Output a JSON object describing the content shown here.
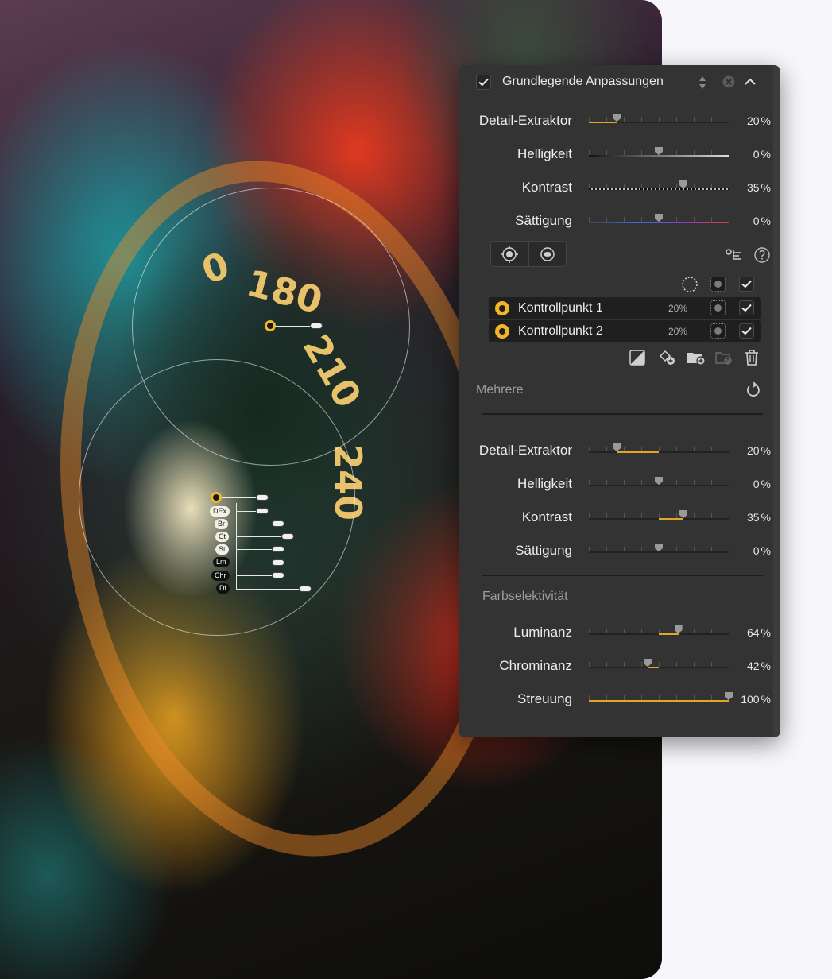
{
  "panel": {
    "title": "Grundlegende Anpassungen",
    "top_sliders": [
      {
        "label": "Detail-Extraktor",
        "value": "20",
        "unit": "%",
        "level": 0.2
      },
      {
        "label": "Helligkeit",
        "value": "0",
        "unit": "%",
        "level": 0.0
      },
      {
        "label": "Kontrast",
        "value": "35",
        "unit": "%",
        "level": 0.35
      },
      {
        "label": "Sättigung",
        "value": "0",
        "unit": "%",
        "level": 0.0
      }
    ],
    "control_points": [
      {
        "name": "Kontrollpunkt 1",
        "percent": "20%"
      },
      {
        "name": "Kontrollpunkt 2",
        "percent": "20%"
      }
    ],
    "multi_section": "Mehrere",
    "bottom_sliders": [
      {
        "label": "Detail-Extraktor",
        "value": "20",
        "unit": "%",
        "level": 0.2
      },
      {
        "label": "Helligkeit",
        "value": "0",
        "unit": "%",
        "level": 0.0
      },
      {
        "label": "Kontrast",
        "value": "35",
        "unit": "%",
        "level": 0.35
      },
      {
        "label": "Sättigung",
        "value": "0",
        "unit": "%",
        "level": 0.0
      }
    ],
    "color_section": "Farbselektivität",
    "color_sliders": [
      {
        "label": "Luminanz",
        "value": "64",
        "unit": "%",
        "level": 0.64
      },
      {
        "label": "Chrominanz",
        "value": "42",
        "unit": "%",
        "level": 0.42
      },
      {
        "label": "Streuung",
        "value": "100",
        "unit": "%",
        "level": 1.0
      }
    ]
  },
  "photo": {
    "gauge_numbers": [
      "180",
      "210",
      "240",
      "0"
    ],
    "point_tags": [
      "DEx",
      "Br",
      "Ct",
      "St",
      "Lm",
      "Chr",
      "Df"
    ]
  },
  "colors": {
    "accent": "#e3a524",
    "panel_bg": "#333333"
  }
}
